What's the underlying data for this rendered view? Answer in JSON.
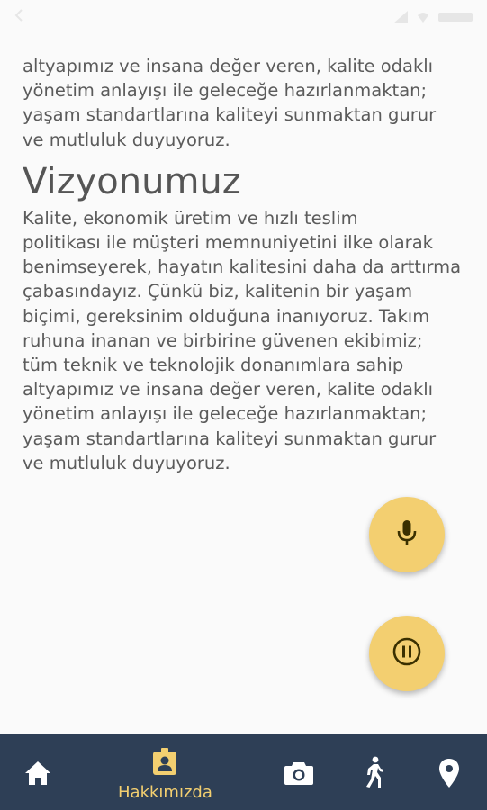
{
  "content": {
    "paragraph_top": "altyapımız ve insana değer veren, kalite odaklı\nyönetim anlayışı ile geleceğe hazırlanmaktan;\nyaşam standartlarına kaliteyi sunmaktan gurur\nve mutluluk duyuyoruz.",
    "heading": "Vizyonumuz",
    "paragraph_vision": "Kalite, ekonomik üretim ve hızlı teslim\npolitikası ile müşteri memnuniyetini ilke olarak\nbenimseyerek, hayatın kalitesini daha da arttırma\nçabasındayız. Çünkü biz, kalitenin bir yaşam\nbiçimi, gereksinim olduğuna inanıyoruz. Takım\nruhuna inanan ve birbirine güvenen ekibimiz;\ntüm teknik ve teknolojik donanımlara sahip\naltyapımız ve insana değer veren, kalite odaklı\nyönetim anlayışı ile geleceğe hazırlanmaktan;\nyaşam standartlarına kaliteyi sunmaktan gurur\nve mutluluk duyuyoruz."
  },
  "fabs": {
    "mic_icon": "mic-icon",
    "pause_icon": "pause-icon"
  },
  "bottom_nav": {
    "items": [
      {
        "icon": "home-icon"
      },
      {
        "icon": "contact-badge-icon",
        "label": "Hakkımızda",
        "active": true
      },
      {
        "icon": "camera-icon"
      },
      {
        "icon": "walk-icon"
      },
      {
        "icon": "location-pin-icon"
      }
    ]
  },
  "colors": {
    "accent": "#f3cf70",
    "nav_background": "#2e3f56",
    "page_background": "#fafafa",
    "text": "#5b5b5b"
  }
}
